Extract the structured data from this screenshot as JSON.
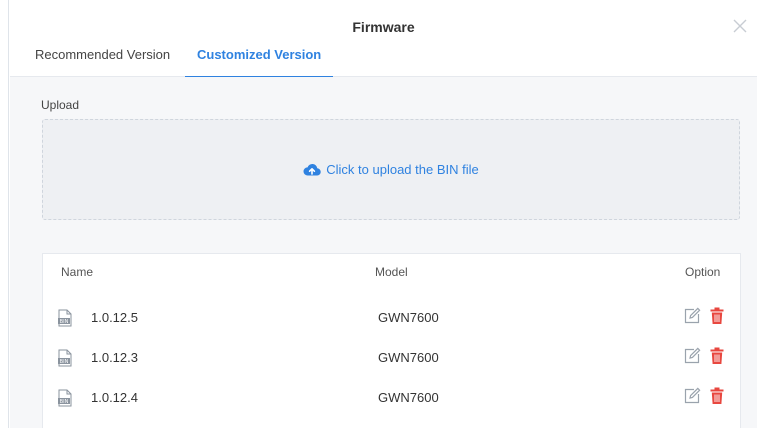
{
  "dialog": {
    "title": "Firmware",
    "close_icon": "close-icon"
  },
  "tabs": [
    {
      "label": "Recommended Version",
      "active": false
    },
    {
      "label": "Customized Version",
      "active": true
    }
  ],
  "upload": {
    "label": "Upload",
    "dropzone_text": "Click to upload the BIN file",
    "icon": "cloud-upload-icon"
  },
  "table": {
    "headers": {
      "name": "Name",
      "model": "Model",
      "option": "Option"
    },
    "rows": [
      {
        "name": "1.0.12.5",
        "model": "GWN7600"
      },
      {
        "name": "1.0.12.3",
        "model": "GWN7600"
      },
      {
        "name": "1.0.12.4",
        "model": "GWN7600"
      }
    ]
  },
  "colors": {
    "accent": "#2f82e0",
    "delete": "#e8473f",
    "edit": "#9aa3ad",
    "background": "#f6f7f9"
  }
}
